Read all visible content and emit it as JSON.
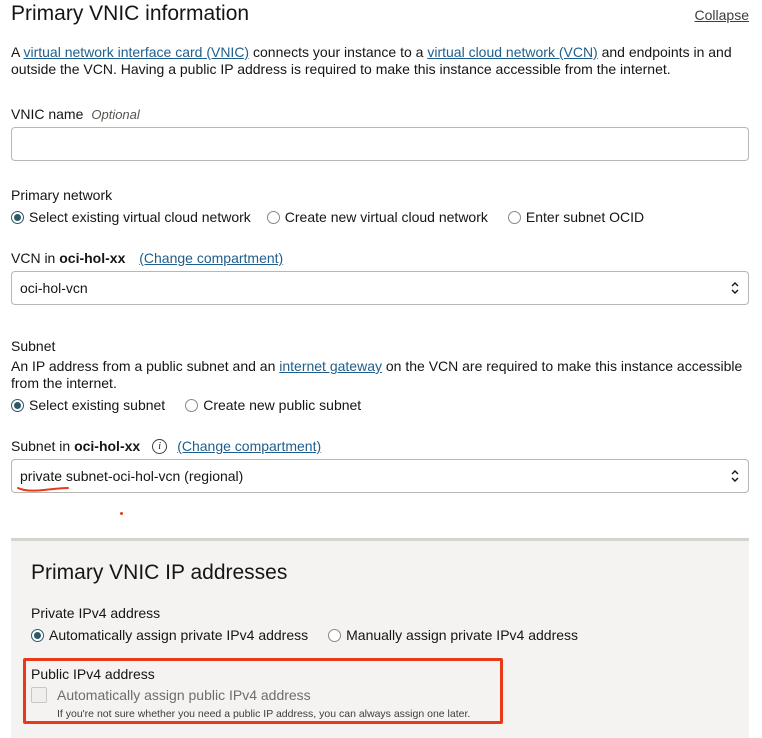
{
  "header": {
    "title": "Primary VNIC information",
    "collapse_label": "Collapse"
  },
  "intro": {
    "t1": "A ",
    "link1": "virtual network interface card (VNIC)",
    "t2": " connects your instance to a ",
    "link2": "virtual cloud network (VCN)",
    "t3": " and endpoints in and outside the VCN. Having a public IP address is required to make this instance accessible from the internet."
  },
  "vnic_name": {
    "label": "VNIC name",
    "optional": "Optional",
    "value": ""
  },
  "primary_network": {
    "label": "Primary network",
    "options": [
      {
        "label": "Select existing virtual cloud network",
        "selected": true
      },
      {
        "label": "Create new virtual cloud network",
        "selected": false
      },
      {
        "label": "Enter subnet OCID",
        "selected": false
      }
    ]
  },
  "vcn": {
    "label_prefix": "VCN in ",
    "compartment": "oci-hol-xx",
    "change_link": "(Change compartment)",
    "selected": "oci-hol-vcn"
  },
  "subnet": {
    "label": "Subnet",
    "desc_1": "An IP address from a public subnet and an ",
    "desc_link": "internet gateway",
    "desc_2": " on the VCN are required to make this instance accessible from the internet.",
    "options": [
      {
        "label": "Select existing subnet",
        "selected": true
      },
      {
        "label": "Create new public subnet",
        "selected": false
      }
    ]
  },
  "subnet_select": {
    "label_prefix": "Subnet in ",
    "compartment": "oci-hol-xx",
    "info_icon_glyph": "i",
    "change_link": "(Change compartment)",
    "selected": "private subnet-oci-hol-vcn (regional)"
  },
  "ip_panel": {
    "title": "Primary VNIC IP addresses",
    "private_label": "Private IPv4 address",
    "private_options": [
      {
        "label": "Automatically assign private IPv4 address",
        "selected": true
      },
      {
        "label": "Manually assign private IPv4 address",
        "selected": false
      }
    ],
    "public_label": "Public IPv4 address",
    "public_checkbox_label": "Automatically assign public IPv4 address",
    "public_checked": false,
    "public_help": "If you're not sure whether you need a public IP address, you can always assign one later."
  },
  "colors": {
    "link": "#1f5e8c",
    "radio_selected": "#2c5967",
    "annotation_red": "#e8391b",
    "panel_bg": "#f4f3f1"
  }
}
